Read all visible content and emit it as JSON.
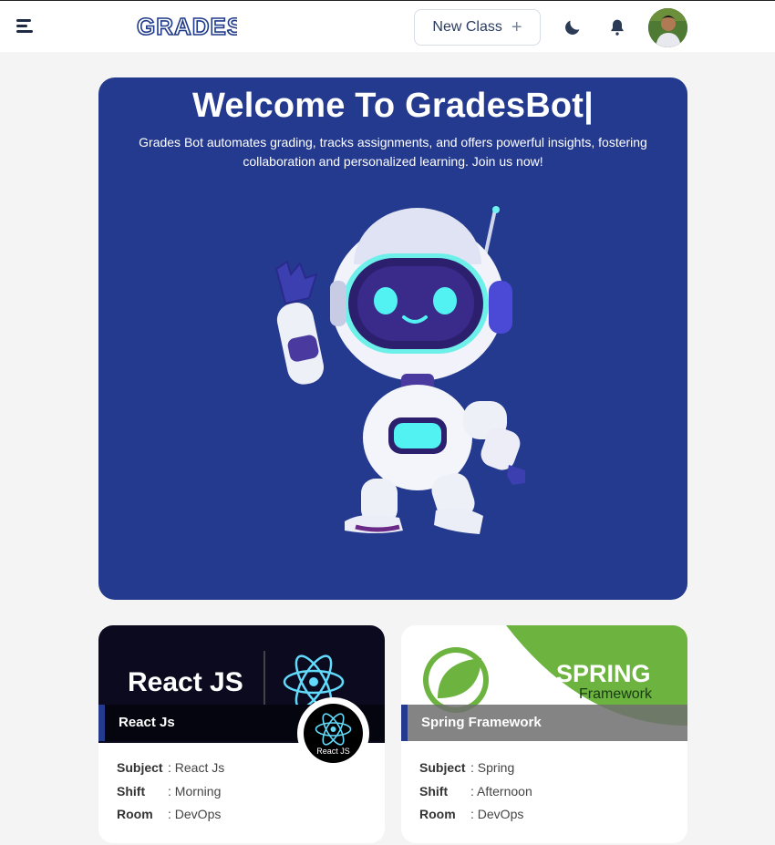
{
  "header": {
    "logo_text": "GRADES",
    "new_class_label": "New Class",
    "new_class_icon": "+"
  },
  "hero": {
    "title": "Welcome To GradesBot|",
    "description": "Grades Bot automates grading, tracks assignments, and offers powerful insights, fostering collaboration and personalized learning. Join us now!"
  },
  "classes": [
    {
      "title": "React Js",
      "banner_text": "React JS",
      "badge_text": "React JS",
      "subject_label": "Subject",
      "subject": "React Js",
      "shift_label": "Shift",
      "shift": "Morning",
      "room_label": "Room",
      "room": "DevOps"
    },
    {
      "title": "Spring Framework",
      "banner_text": "SPRING",
      "banner_subtext": "Framework",
      "subject_label": "Subject",
      "subject": "Spring",
      "shift_label": "Shift",
      "shift": "Afternoon",
      "room_label": "Room",
      "room": "DevOps"
    }
  ],
  "colors": {
    "hero_bg": "#243a8f",
    "page_bg": "#f4f4f4",
    "react_cyan": "#61dafb",
    "spring_green": "#6db33f"
  }
}
